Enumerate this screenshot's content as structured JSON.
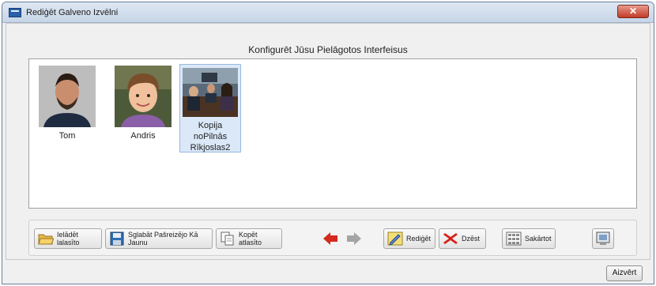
{
  "window": {
    "title": "Rediģēt Galveno Izvēlni",
    "close_glyph": "✕"
  },
  "panel": {
    "heading": "Konfigurēt Jūsu Pielāgotos Interfeisus"
  },
  "gallery": {
    "items": [
      {
        "label": "Tom",
        "icon": "person-photo-icon",
        "selected": false
      },
      {
        "label": "Andris",
        "icon": "child-photo-icon",
        "selected": false
      },
      {
        "label": "Kopija noPilnās Rīkjoslas2",
        "icon": "meeting-photo-icon",
        "selected": true
      }
    ]
  },
  "toolbar": {
    "load_label": "Ielādēt lalasīto",
    "save_as_new_label": "Sglabāt Pašreizējo Kā Jaunu",
    "copy_label": "Kopēt atlasīto",
    "edit_label": "Rediģēt",
    "delete_label": "Dzēst",
    "arrange_label": "Sakārtot"
  },
  "footer": {
    "close_label": "Aizvērt"
  },
  "colors": {
    "back_arrow": "#d42a1f",
    "forward_arrow": "#9a9a9a",
    "delete_x": "#d8201a",
    "selection": "#dbe8f8"
  }
}
